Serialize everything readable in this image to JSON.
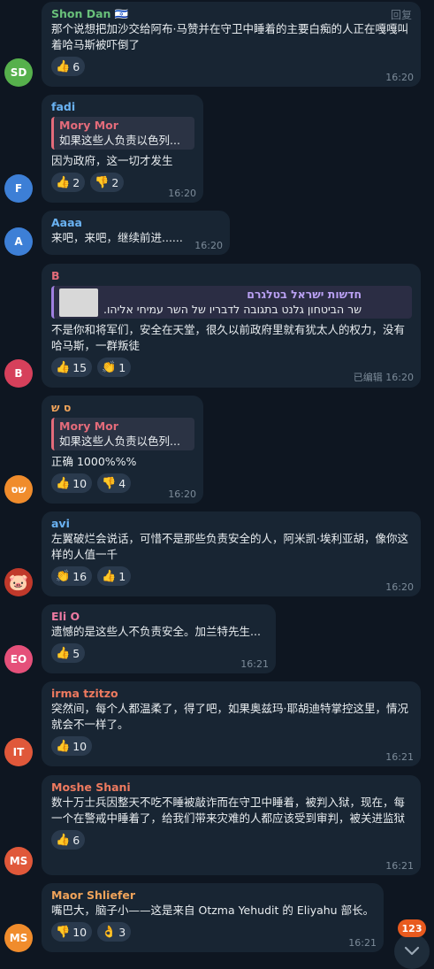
{
  "messages": [
    {
      "sender": "Shon Dan 🇮🇱",
      "reply_label": "回复",
      "text": "那个说想把加沙交给阿布·马赞并在守卫中睡着的主要白痴的人正在嘎嘎叫着哈马斯被吓倒了",
      "reactions": [
        {
          "emoji": "👍",
          "count": "6"
        }
      ],
      "time": "16:20",
      "avatar": "SD",
      "avatar_color": "#56b04c",
      "name_color": "#69c07a"
    },
    {
      "sender": "fadi",
      "quote": {
        "name": "Mory Mor",
        "text": "如果这些人负责以色列..."
      },
      "text": "因为政府，这一切才发生",
      "reactions": [
        {
          "emoji": "👍",
          "count": "2"
        },
        {
          "emoji": "👎",
          "count": "2"
        }
      ],
      "time": "16:20",
      "avatar": "F",
      "avatar_color": "#3d7fd6",
      "name_color": "#6ab2f2"
    },
    {
      "sender": "Aaaa",
      "text": "来吧，来吧，继续前进......",
      "time": "16:20",
      "avatar": "A",
      "avatar_color": "#3d7fd6",
      "name_color": "#6ab2f2"
    },
    {
      "sender": "B",
      "quote": {
        "name": "חדשות ישראל בטלגרם",
        "text": "שר הביטחון גלנט בתגובה לדבריו של השר עמיחי אליהו."
      },
      "text": "不是你和将军们，安全在天堂，很久以前政府里就有犹太人的权力，没有哈马斯，一群叛徒",
      "reactions": [
        {
          "emoji": "👍",
          "count": "15"
        },
        {
          "emoji": "👏",
          "count": "1"
        }
      ],
      "edited": "已编辑",
      "time": "16:20",
      "avatar": "B",
      "avatar_color": "#d6405b",
      "name_color": "#e36b7a"
    },
    {
      "sender": "ס ש",
      "quote": {
        "name": "Mory Mor",
        "text": "如果这些人负责以色列..."
      },
      "text": "正确 1000%%%",
      "reactions": [
        {
          "emoji": "👍",
          "count": "10"
        },
        {
          "emoji": "👎",
          "count": "4"
        }
      ],
      "time": "16:20",
      "avatar": "שס",
      "avatar_color": "#f08c2c",
      "name_color": "#f0a35a"
    },
    {
      "sender": "avi",
      "text": "左翼破烂会说话，可惜不是那些负责安全的人，阿米凯·埃利亚胡，像你这样的人值一千",
      "reactions": [
        {
          "emoji": "👏",
          "count": "16"
        },
        {
          "emoji": "👍",
          "count": "1"
        }
      ],
      "time": "16:20",
      "avatar": "🐷",
      "avatar_color": "#c0392b",
      "name_color": "#6ab2f2"
    },
    {
      "sender": "Eli O",
      "text": "遗憾的是这些人不负责安全。加兰特先生...",
      "reactions": [
        {
          "emoji": "👍",
          "count": "5"
        }
      ],
      "time": "16:21",
      "avatar": "EO",
      "avatar_color": "#e5507a",
      "name_color": "#ee7aa2"
    },
    {
      "sender": "irma tzitzo",
      "text": "突然间，每个人都温柔了，得了吧，如果奥兹玛·耶胡迪特掌控这里，情况就会不一样了。",
      "reactions": [
        {
          "emoji": "👍",
          "count": "10"
        }
      ],
      "time": "16:21",
      "avatar": "IT",
      "avatar_color": "#e0583a",
      "name_color": "#ee7a5f"
    },
    {
      "sender": "Moshe Shani",
      "text": "数十万士兵因整天不吃不睡被敲诈而在守卫中睡着，被判入狱，现在，每一个在警戒中睡着了，给我们带来灾难的人都应该受到审判，被关进监狱",
      "reactions": [
        {
          "emoji": "👍",
          "count": "6"
        }
      ],
      "time": "16:21",
      "avatar": "MS",
      "avatar_color": "#e0583a",
      "name_color": "#ee7a5f"
    },
    {
      "sender": "Maor Shliefer",
      "text": "嘴巴大，脑子小——这是来自 Otzma Yehudit 的 Eliyahu 部长。",
      "reactions": [
        {
          "emoji": "👎",
          "count": "10"
        },
        {
          "emoji": "👌",
          "count": "3"
        }
      ],
      "time": "16:21",
      "avatar": "MS",
      "avatar_color": "#f08c2c",
      "name_color": "#f0a35a"
    }
  ],
  "unread_badge": "123",
  "scroll_icon": "chevron-down-icon"
}
